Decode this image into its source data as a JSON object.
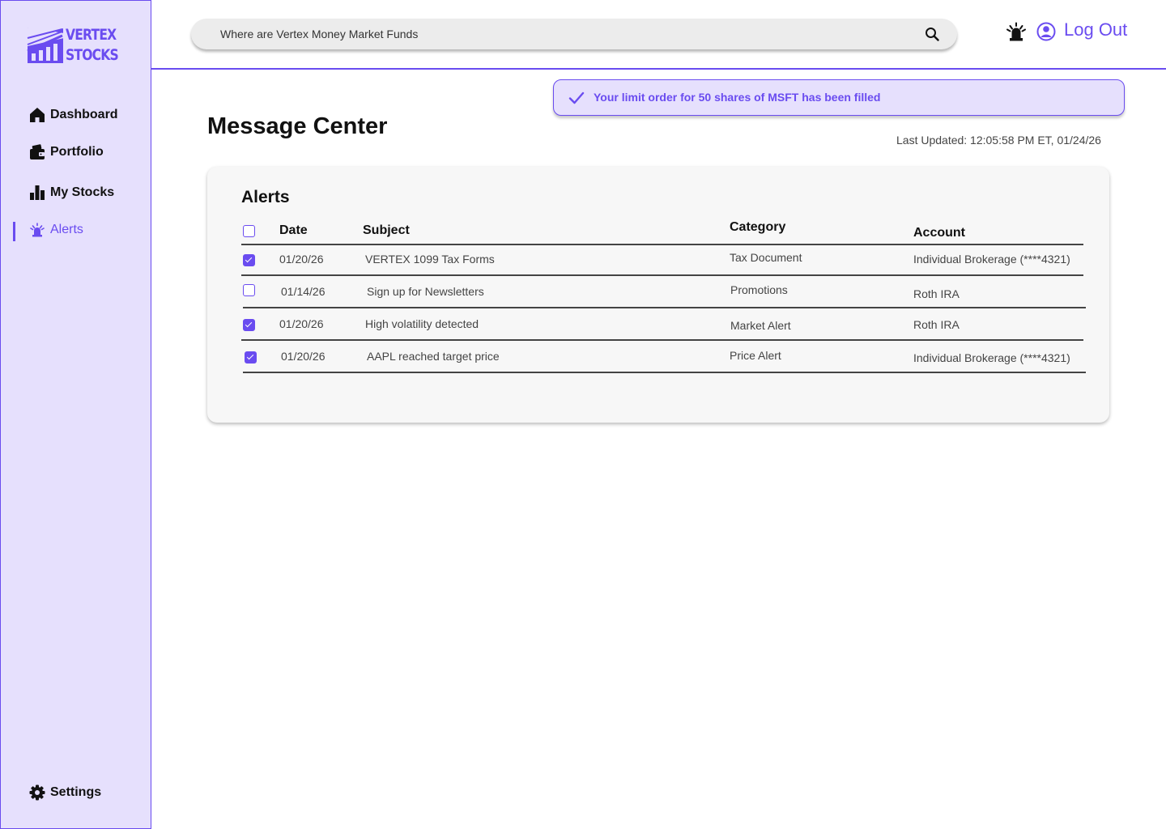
{
  "brand": {
    "name_line1": "VERTEX",
    "name_line2": "STOCKS",
    "accent": "#6a4cf0",
    "sidebar_bg": "#e6e0fd"
  },
  "sidebar": {
    "items": [
      {
        "label": "Dashboard",
        "icon": "home-icon",
        "active": false
      },
      {
        "label": "Portfolio",
        "icon": "wallet-icon",
        "active": false
      },
      {
        "label": "My Stocks",
        "icon": "bar-chart-icon",
        "active": false
      },
      {
        "label": "Alerts",
        "icon": "alarm-bell-icon",
        "active": true
      }
    ],
    "settings": {
      "label": "Settings",
      "icon": "gear-icon"
    }
  },
  "header": {
    "search": {
      "placeholder": "Where are Vertex Money Market Funds",
      "icon": "search-icon"
    },
    "bell_icon": "alarm-bell-icon",
    "user_icon": "user-circle-icon",
    "logout_label": "Log Out"
  },
  "toast": {
    "icon": "check-icon",
    "text": "Your limit order for 50 shares of MSFT has been filled"
  },
  "page": {
    "title": "Message Center",
    "last_updated": "Last Updated: 12:05:58 PM ET, 01/24/26"
  },
  "alerts": {
    "title": "Alerts",
    "select_all_checked": false,
    "columns": {
      "date": "Date",
      "subject": "Subject",
      "category": "Category",
      "account": "Account"
    },
    "rows": [
      {
        "checked": true,
        "date": "01/20/26",
        "subject": "VERTEX 1099 Tax Forms",
        "category": "Tax Document",
        "account": "Individual Brokerage (****4321)"
      },
      {
        "checked": false,
        "date": "01/14/26",
        "subject": "Sign up for Newsletters",
        "category": "Promotions",
        "account": "Roth IRA"
      },
      {
        "checked": true,
        "date": "01/20/26",
        "subject": "High volatility detected",
        "category": "Market Alert",
        "account": "Roth IRA"
      },
      {
        "checked": true,
        "date": "01/20/26",
        "subject": "AAPL reached target price",
        "category": "Price Alert",
        "account": "Individual Brokerage (****4321)"
      }
    ]
  }
}
